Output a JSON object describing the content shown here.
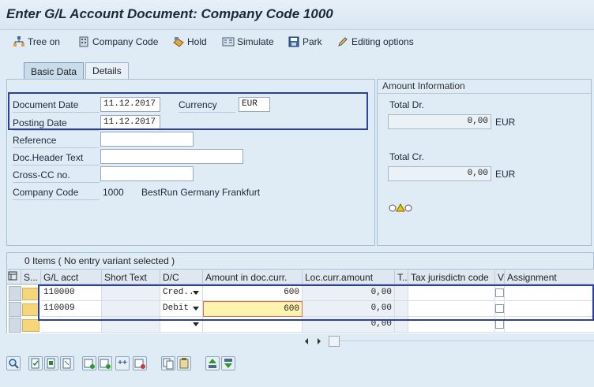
{
  "title": "Enter G/L Account Document: Company Code 1000",
  "toolbar": {
    "tree_on": "Tree on",
    "company_code": "Company Code",
    "hold": "Hold",
    "simulate": "Simulate",
    "park": "Park",
    "editing_options": "Editing options"
  },
  "tabs": [
    {
      "label": "Basic Data",
      "active": true
    },
    {
      "label": "Details",
      "active": false
    }
  ],
  "basic_data": {
    "document_date_label": "Document Date",
    "document_date": "11.12.2017",
    "currency_label": "Currency",
    "currency": "EUR",
    "posting_date_label": "Posting Date",
    "posting_date": "11.12.2017",
    "reference_label": "Reference",
    "reference": "",
    "doc_header_text_label": "Doc.Header Text",
    "doc_header_text": "",
    "cross_cc_label": "Cross-CC no.",
    "cross_cc": "",
    "company_code_label": "Company Code",
    "company_code": "1000",
    "company_name": "BestRun Germany Frankfurt"
  },
  "amount_info": {
    "header": "Amount Information",
    "total_dr_label": "Total Dr.",
    "total_dr": "0,00",
    "total_dr_currency": "EUR",
    "total_cr_label": "Total Cr.",
    "total_cr": "0,00",
    "total_cr_currency": "EUR"
  },
  "items": {
    "summary": "0 Items ( No entry variant selected )",
    "columns": [
      "S...",
      "G/L acct",
      "Short Text",
      "D/C",
      "Amount in doc.curr.",
      "Loc.curr.amount",
      "T..",
      "Tax jurisdictn code",
      "V",
      "Assignment"
    ],
    "rows": [
      {
        "gl_acct": "110000",
        "short_text": "",
        "dc": "Cred...",
        "amount": "600",
        "loc_amount": "0,00"
      },
      {
        "gl_acct": "110009",
        "short_text": "",
        "dc": "Debit",
        "amount": "600",
        "loc_amount": "0,00"
      },
      {
        "gl_acct": "",
        "short_text": "",
        "dc": "",
        "amount": "",
        "loc_amount": "0,00"
      }
    ]
  },
  "colors": {
    "highlight": "#2e3f9e",
    "status_yellow": "#f5d67a",
    "edit_yellow": "#fff3b0"
  }
}
